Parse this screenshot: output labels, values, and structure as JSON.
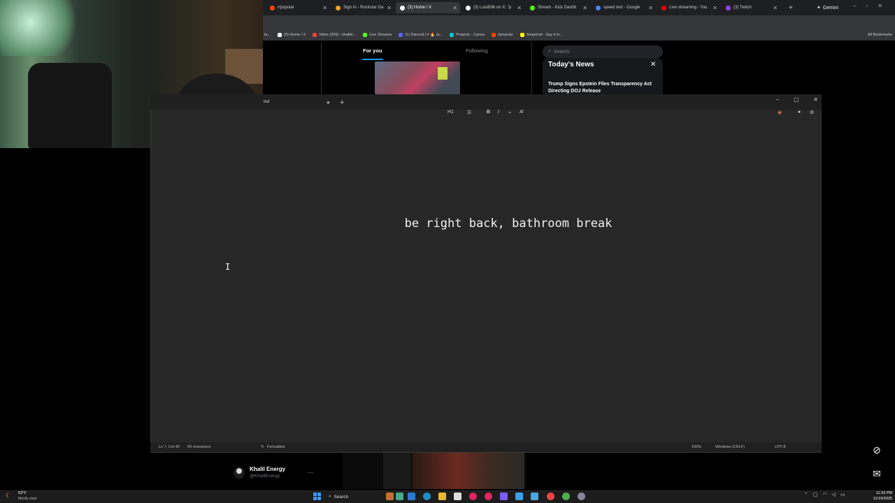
{
  "browser": {
    "tabs": [
      {
        "label": "r/popular",
        "color": "#ff4500"
      },
      {
        "label": "Sign In - Rockstar Ga",
        "color": "#f5a623"
      },
      {
        "label": "(3) Home / X",
        "color": "#ffffff",
        "active": true
      },
      {
        "label": "(3) Luis80lb on X: \"p",
        "color": "#ffffff"
      },
      {
        "label": "Stream - Kick Dashb",
        "color": "#53fc18"
      },
      {
        "label": "speed test - Google",
        "color": "#4285f4"
      },
      {
        "label": "Live streaming - You",
        "color": "#ff0000"
      },
      {
        "label": "(3) Twitch",
        "color": "#9146ff"
      }
    ],
    "gemini_label": "Gemini",
    "bookmarks": [
      {
        "label": "(5) Home / X",
        "color": "#ffffff"
      },
      {
        "label": "Inbox (359) - khalile...",
        "color": "#ea4335"
      },
      {
        "label": "Live Streams",
        "color": "#53fc18"
      },
      {
        "label": "(1) Discord | # 🔥 (a...",
        "color": "#5865f2"
      },
      {
        "label": "Projects - Canva",
        "color": "#00c4cc"
      },
      {
        "label": "r/popular",
        "color": "#ff4500"
      },
      {
        "label": "Snapchat - Say it in...",
        "color": "#fffc00"
      }
    ],
    "all_bookmarks": "All Bookmarks"
  },
  "x": {
    "tab_for_you": "For you",
    "tab_following": "Following",
    "search_placeholder": "Search",
    "news_title": "Today's News",
    "news_headline": "Trump Signs Epstein Files Transparency Act Directing DOJ Release"
  },
  "notepad": {
    "tab_label": "ted",
    "text": "be right back, bathroom break",
    "toolbar": {
      "heading": "H1",
      "list": "☰",
      "bold": "B",
      "italic": "I",
      "link": "⌁",
      "clear": "A̸"
    },
    "status": {
      "position": "Ln 7, Col 49",
      "characters": "69 characters",
      "format": "Formatted",
      "zoom": "100%",
      "line_ending": "Windows (CRLF)",
      "encoding": "UTF-8"
    }
  },
  "tweet": {
    "name": "Khalil Energy",
    "handle": "@KhalilEnergy"
  },
  "taskbar": {
    "temperature": "53°F",
    "weather": "Mostly clear",
    "search_label": "Search",
    "time": "11:33 PM",
    "date": "11/19/2025"
  }
}
